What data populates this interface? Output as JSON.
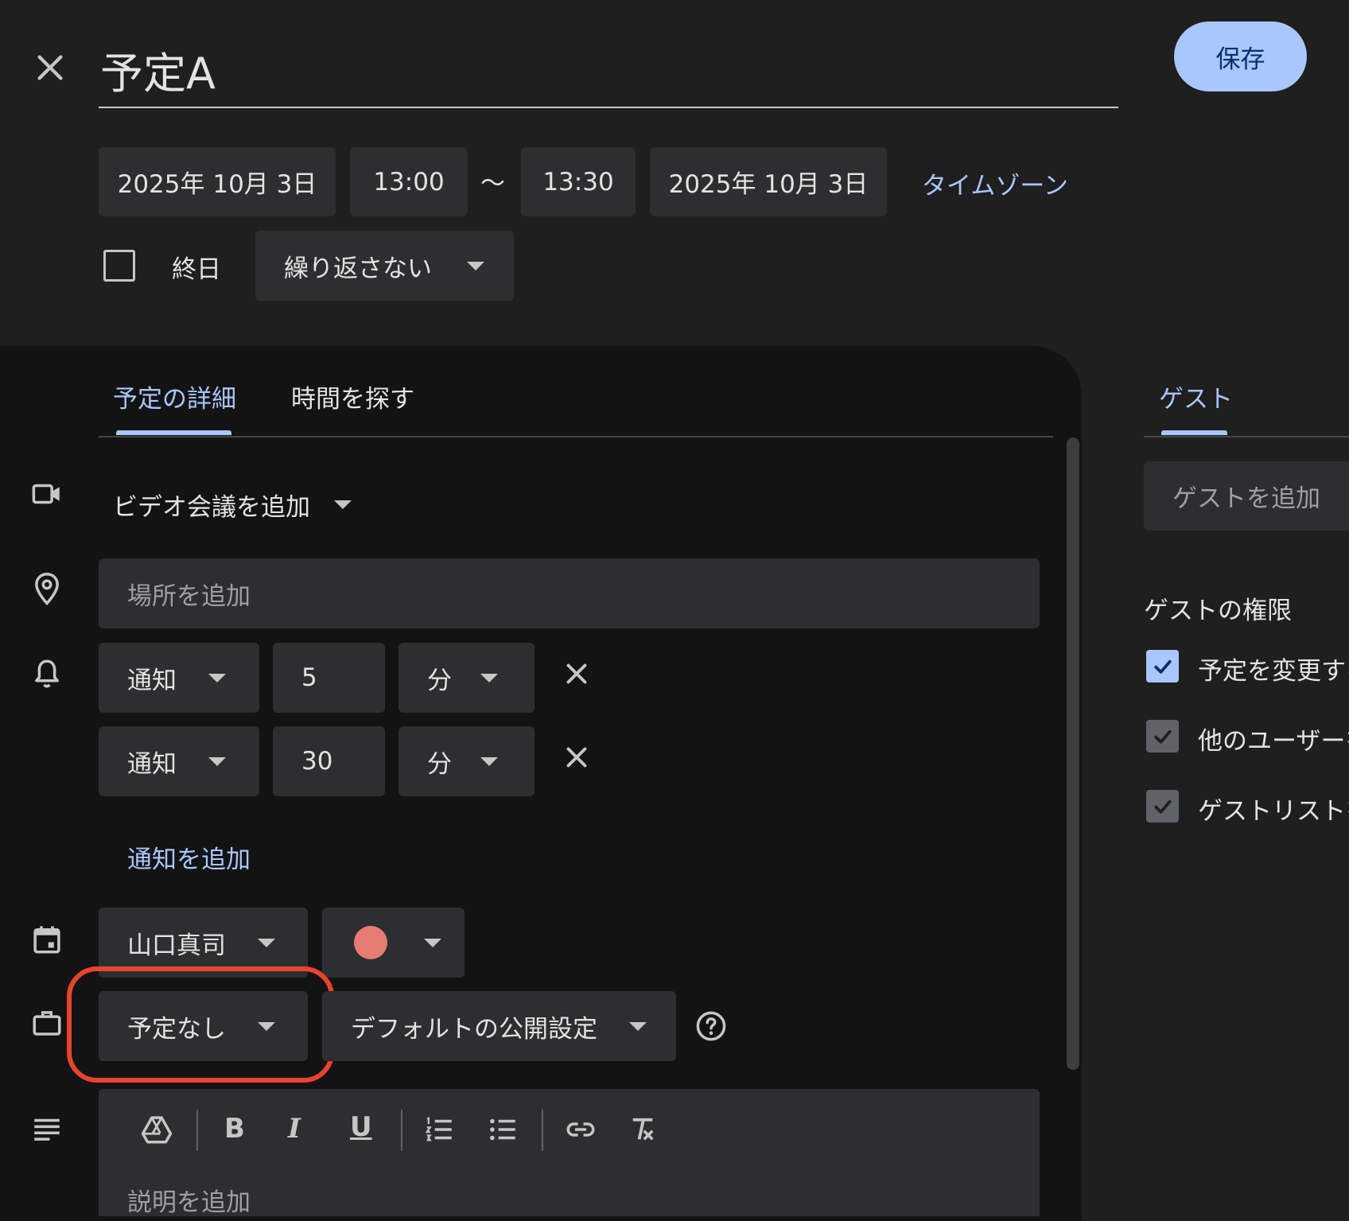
{
  "header": {
    "title": "予定A",
    "save_label": "保存"
  },
  "datetime": {
    "start_date": "2025年 10月 3日",
    "start_time": "13:00",
    "separator": "〜",
    "end_time": "13:30",
    "end_date": "2025年 10月 3日",
    "timezone_label": "タイムゾーン"
  },
  "allday": {
    "label": "終日",
    "checked": false,
    "repeat_value": "繰り返さない"
  },
  "tabs": [
    {
      "label": "予定の詳細",
      "active": true
    },
    {
      "label": "時間を探す",
      "active": false
    }
  ],
  "details": {
    "video_label": "ビデオ会議を追加",
    "location_placeholder": "場所を追加",
    "notifications": [
      {
        "type": "通知",
        "value": "5",
        "unit": "分"
      },
      {
        "type": "通知",
        "value": "30",
        "unit": "分"
      }
    ],
    "add_notification_label": "通知を追加",
    "calendar_owner": "山口真司",
    "event_color": "#e67c73",
    "availability": "予定なし",
    "visibility": "デフォルトの公開設定",
    "description_placeholder": "説明を追加",
    "highlight_color": "#e8432e"
  },
  "guests": {
    "tab_label": "ゲスト",
    "add_placeholder": "ゲストを追加",
    "permissions_title": "ゲストの権限",
    "permissions": [
      {
        "label": "予定を変更する",
        "checked": true
      },
      {
        "label": "他のユーザーを",
        "checked": true
      },
      {
        "label": "ゲストリストを",
        "checked": true
      }
    ]
  },
  "colors": {
    "background": "#1f1f1f",
    "panel": "#131314",
    "field": "#2d2e30",
    "accent": "#a8c7fa",
    "save_button": "#a8c7fa"
  }
}
